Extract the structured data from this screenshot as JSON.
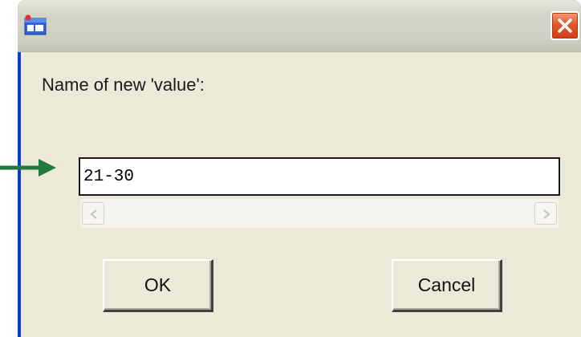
{
  "dialog": {
    "prompt": "Name of new 'value':",
    "input_value": "21-30",
    "ok_label": "OK",
    "cancel_label": "Cancel"
  },
  "icons": {
    "app": "application-window-icon",
    "close": "close-icon",
    "scroll_left": "chevron-left-icon",
    "scroll_right": "chevron-right-icon",
    "pointer": "arrow-right-icon"
  },
  "colors": {
    "window_border": "#0a3fbd",
    "dialog_background": "#ece9d8",
    "close_button": "#e2562c",
    "annotation_arrow": "#1f7a3d"
  }
}
